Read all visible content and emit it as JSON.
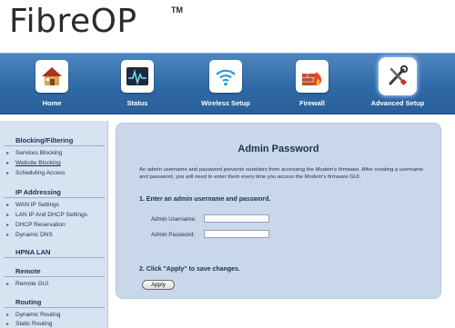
{
  "brand": {
    "name": "FibreOP",
    "trademark": "TM"
  },
  "nav": {
    "items": [
      {
        "label": "Home",
        "icon": "home-icon"
      },
      {
        "label": "Status",
        "icon": "status-monitor-icon"
      },
      {
        "label": "Wireless Setup",
        "icon": "wireless-icon"
      },
      {
        "label": "Firewall",
        "icon": "firewall-icon"
      },
      {
        "label": "Advanced Setup",
        "icon": "tools-icon"
      }
    ],
    "active": "Advanced Setup"
  },
  "sidebar": {
    "sections": [
      {
        "title": "Blocking/Filtering",
        "items": [
          "Services Blocking",
          "Website Blocking",
          "Scheduling Access"
        ]
      },
      {
        "title": "IP Addressing",
        "items": [
          "WAN IP Settings",
          "LAN IP And DHCP Settings",
          "DHCP Reservation",
          "Dynamic DNS"
        ]
      },
      {
        "title": "HPNA LAN",
        "items": []
      },
      {
        "title": "Remote",
        "items": [
          "Remote GUI"
        ]
      },
      {
        "title": "Routing",
        "items": [
          "Dynamic Routing",
          "Static Routing"
        ]
      }
    ],
    "active_item": "Website Blocking"
  },
  "main": {
    "title": "Admin Password",
    "description": "An admin username and password prevents outsiders from accessing the Modem's firmware. After creating a username and password, you will need to enter them every time you access the Modem's firmware GUI.",
    "step1": "1. Enter an admin username and password.",
    "username_label": "Admin Username:",
    "username_value": "",
    "password_label": "Admin Password:",
    "password_value": "",
    "step2": "2. Click \"Apply\" to save changes.",
    "apply_label": "Apply"
  },
  "colors": {
    "navbar": "#2f6aa8",
    "sidebar": "#d7e3f1",
    "panel": "#c8d8ea",
    "text": "#1c2f52"
  }
}
